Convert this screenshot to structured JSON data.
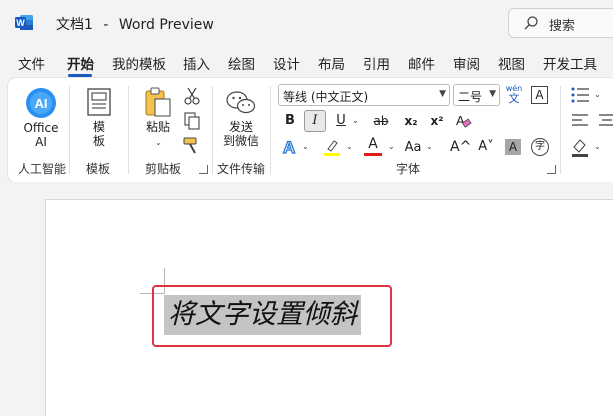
{
  "titlebar": {
    "doc_name": "文档1",
    "separator": "-",
    "app_name": "Word Preview"
  },
  "search": {
    "placeholder": "搜索"
  },
  "tabs": [
    "文件",
    "开始",
    "我的模板",
    "插入",
    "绘图",
    "设计",
    "布局",
    "引用",
    "邮件",
    "审阅",
    "视图",
    "开发工具"
  ],
  "active_tab": "开始",
  "ribbon": {
    "office_ai": {
      "label_line1": "Office",
      "label_line2": "AI",
      "group": "人工智能"
    },
    "template": {
      "label_line1": "模",
      "label_line2": "板",
      "group": "模板"
    },
    "clipboard": {
      "paste": "粘贴",
      "group": "剪贴板"
    },
    "file_transfer": {
      "label_line1": "发送",
      "label_line2": "到微信",
      "group": "文件传输"
    },
    "font": {
      "font_name": "等线 (中文正文)",
      "font_size": "二号",
      "pinyin": "wén",
      "pinyin_char": "文",
      "border_char": "A",
      "bold": "B",
      "italic": "I",
      "underline": "U",
      "strikethrough": "ab",
      "subscript": "x₂",
      "superscript": "x²",
      "font_color_letter": "A",
      "change_case": "Aa",
      "grow": "A^",
      "shrink": "A˅",
      "char_shading": "A",
      "enclose_char": "字",
      "group": "字体"
    }
  },
  "document": {
    "text": "将文字设置倾斜"
  },
  "colors": {
    "accent": "#185abd",
    "highlight_yellow": "#ffff00",
    "font_red": "#e21a1a",
    "selection_box": "#e0343f"
  }
}
